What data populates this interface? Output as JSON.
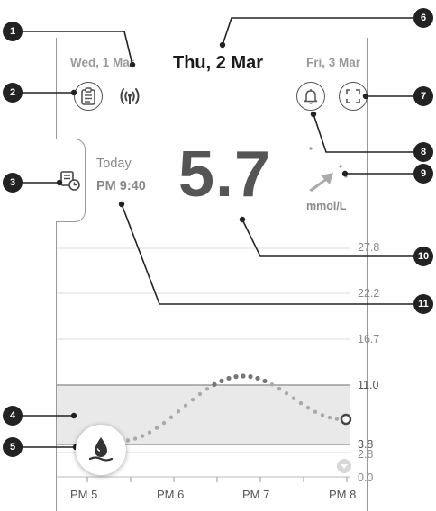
{
  "header": {
    "prev_date": "Wed, 1 Mar",
    "current_date": "Thu, 2 Mar",
    "next_date": "Fri, 3 Mar"
  },
  "icons": {
    "report": "clipboard-icon",
    "signal": "signal-icon",
    "notification": "bell-icon",
    "fullscreen": "fullscreen-icon",
    "history": "history-icon",
    "meal": "blood-drop-icon",
    "trend": "trend-arrow-icon"
  },
  "reading": {
    "day": "Today",
    "time": "PM 9:40",
    "value": "5.7",
    "unit": "mmol/L"
  },
  "chart_data": {
    "type": "line",
    "y_gridlines": [
      "27.8",
      "22.2",
      "16.7",
      "11.0",
      "3.8",
      "2.8",
      "0.0"
    ],
    "target_range": [
      3.8,
      11.0
    ],
    "x_ticks": [
      "PM 5",
      "PM 6",
      "PM 7",
      "PM 8"
    ]
  },
  "callouts": [
    "1",
    "2",
    "3",
    "4",
    "5",
    "6",
    "7",
    "8",
    "9",
    "10",
    "11"
  ],
  "colors": {
    "accent": "#555555",
    "target_band": "#e9e9e9",
    "callout": "#222222"
  }
}
